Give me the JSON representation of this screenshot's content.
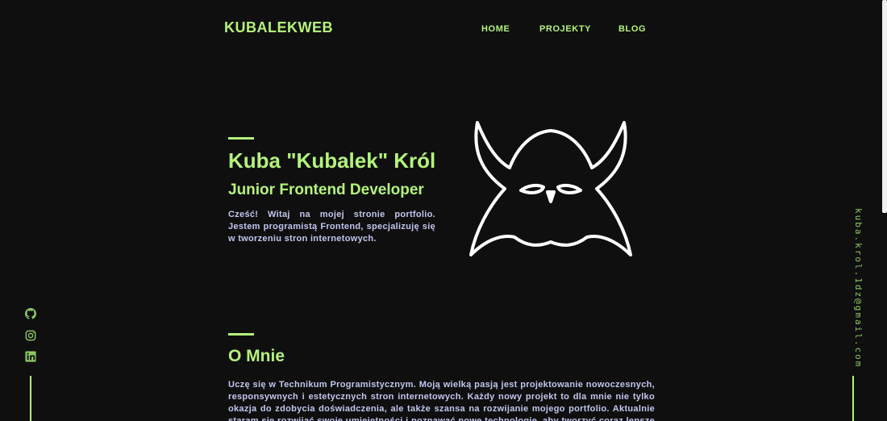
{
  "header": {
    "brand": "KUBALEKWEB",
    "nav": [
      "HOME",
      "PROJEKTY",
      "BLOG"
    ]
  },
  "hero": {
    "name": "Kuba \"Kubalek\" Król",
    "role": "Junior Frontend Developer",
    "intro": "Cześć! Witaj na mojej stronie portfolio. Jestem programistą Frontend, specjalizuję się w tworzeniu stron internetowych."
  },
  "about": {
    "title": "O Mnie",
    "text": "Uczę się w Technikum Programistycznym. Moją wielką pasją jest projektowanie nowoczesnych, responsywnych i estetycznych stron internetowych. Każdy nowy projekt to dla mnie nie tylko okazja do zdobycia doświadczenia, ale także szansa na rozwijanie mojego portfolio. Aktualnie staram się rozwijać swoje umiejętności i poznawać nowe technologie, aby tworzyć coraz lepsze projekty."
  },
  "social": {
    "icons": [
      "github-icon",
      "instagram-icon",
      "linkedin-icon"
    ]
  },
  "contact": {
    "email": "kuba.krol.1dz@gmail.com"
  },
  "colors": {
    "background": "#0f0f0f",
    "accent": "#b3f37c",
    "body_text": "#c2c6ee",
    "logo_stroke": "#ffffff"
  }
}
